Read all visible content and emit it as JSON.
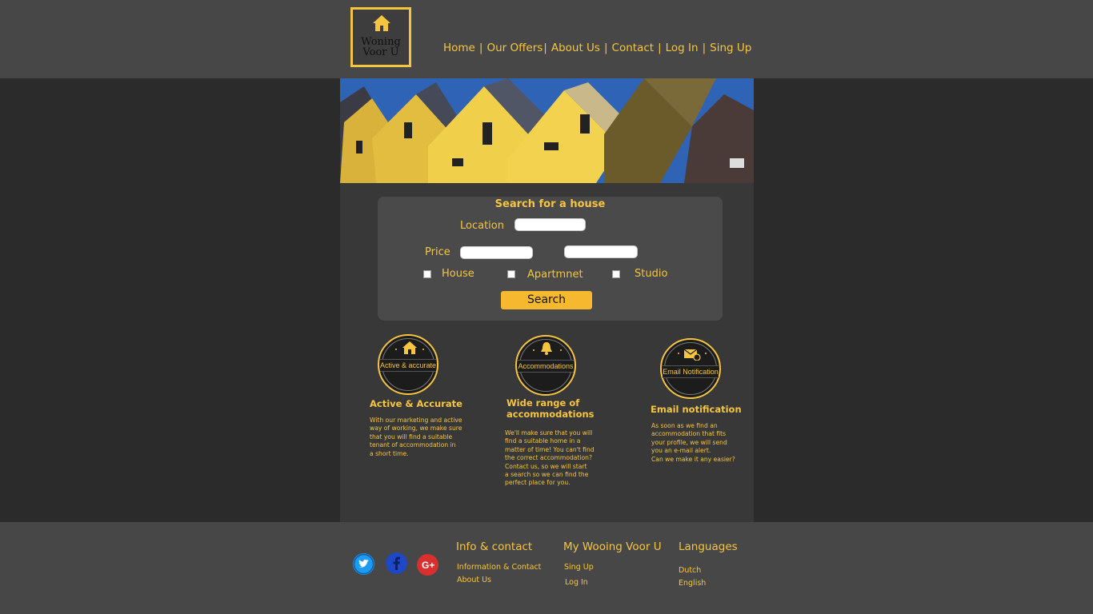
{
  "logo": {
    "line1": "Woning",
    "line2": "Voor U"
  },
  "nav": {
    "home": "Home",
    "offers": "Our Offers",
    "about": "About Us",
    "contact": "Contact",
    "login": "Log In",
    "signup": "Sing Up",
    "separator": "|"
  },
  "search": {
    "title": "Search for a house",
    "location_label": "Location",
    "price_label": "Price",
    "types": [
      "House",
      "Apartmnet",
      "Studio"
    ],
    "button": "Search"
  },
  "features": [
    {
      "badge": "Active & accurate",
      "title": "Active & Accurate",
      "text": "With our marketing and active\nway of working, we make sure\nthat you will find a suitable\ntenant of accommodation in\na short time."
    },
    {
      "badge": "Accommodations",
      "title_line1": "Wide range of",
      "title_line2": "accommodations",
      "text": "We'll make sure that you will\nfind a suitable home in a\nmatter of time! You can't find\nthe correct accommodation?\nContact us, so we will start\na search so we can find the\nperfect place for you."
    },
    {
      "badge": "Email Notification",
      "title": "Email notification",
      "text": "As soon as we find an\naccommodation that fits\nyour profile, we will send\nyou an e-mail alert.\nCan we make it any easier?"
    }
  ],
  "footer": {
    "col1": {
      "heading": "Info & contact",
      "links": [
        "Information & Contact",
        "About Us"
      ]
    },
    "col2": {
      "heading": "My Wooing Voor U",
      "links": [
        "Sing Up",
        "Log In"
      ]
    },
    "col3": {
      "heading": "Languages",
      "links": [
        "Dutch",
        "English"
      ]
    },
    "social": [
      "twitter-icon",
      "facebook-icon",
      "google-plus-icon"
    ]
  },
  "colors": {
    "accent": "#f5c542",
    "button": "#f5b82e",
    "header_bg": "#474747",
    "main_bg": "#383838"
  }
}
